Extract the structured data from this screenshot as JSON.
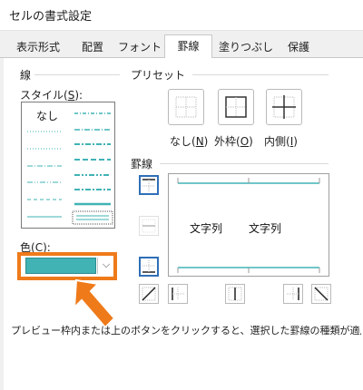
{
  "window": {
    "title": "セルの書式設定"
  },
  "tabs": [
    {
      "label": "表示形式",
      "active": false
    },
    {
      "label": "配置",
      "active": false
    },
    {
      "label": "フォント",
      "active": false
    },
    {
      "label": "罫線",
      "active": true
    },
    {
      "label": "塗りつぶし",
      "active": false
    },
    {
      "label": "保護",
      "active": false
    }
  ],
  "line_group": {
    "title": "線",
    "style_label": "スタイル(",
    "style_key": "S",
    "style_label_end": "):",
    "none_label": "なし",
    "color_label": "色(",
    "color_key": "C",
    "color_label_end": "):",
    "selected_color": "#41b3b5",
    "highlight_color": "#ef7a1a",
    "arrow_color": "#ef7a1a"
  },
  "presets": {
    "title": "プリセット",
    "items": [
      {
        "label": "なし(",
        "key": "N",
        "end": ")"
      },
      {
        "label": "外枠(",
        "key": "O",
        "end": ")"
      },
      {
        "label": "内側(",
        "key": "I",
        "end": ")"
      }
    ]
  },
  "border": {
    "title": "罫線",
    "preview_text_left": "文字列",
    "preview_text_right": "文字列"
  },
  "hint": "プレビュー枠内または上のボタンをクリックすると、選択した罫線の種類が適用されます。"
}
